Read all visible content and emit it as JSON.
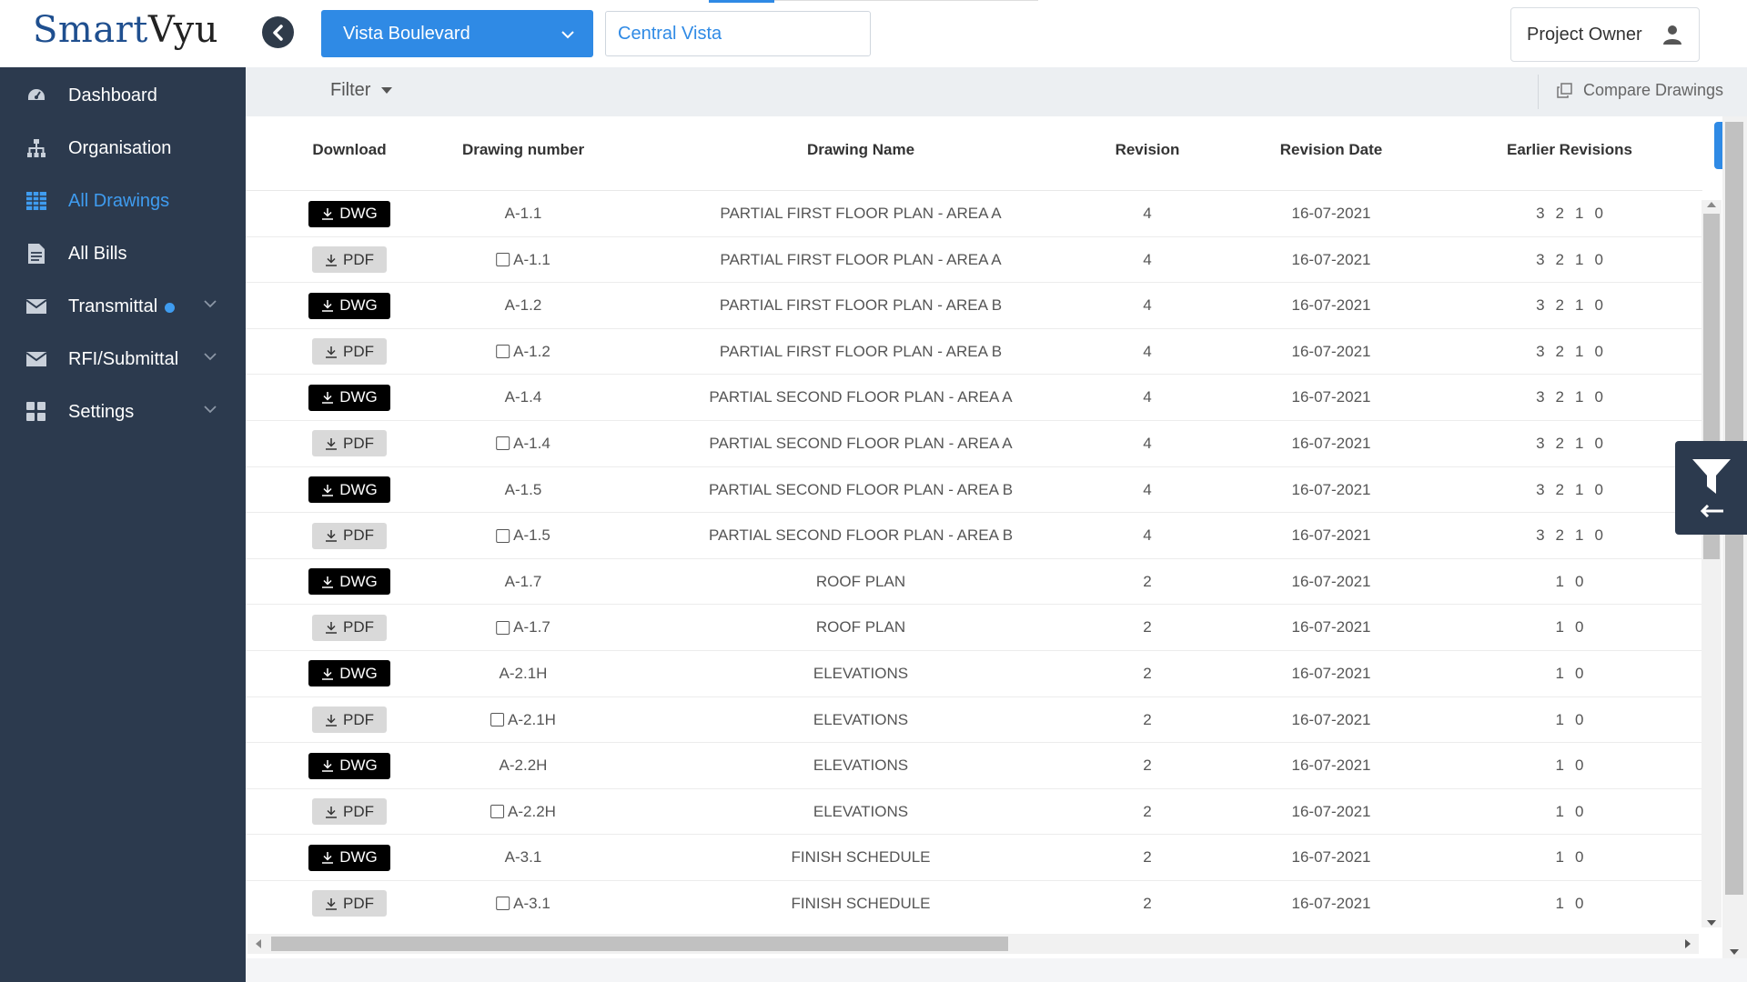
{
  "header": {
    "logo_smart": "Smart",
    "logo_vyu": "Vyu",
    "project_select": "Vista Boulevard",
    "site_input": "Central Vista",
    "user_label": "Project Owner"
  },
  "sidebar": {
    "items": [
      {
        "label": "Dashboard",
        "icon": "dashboard-icon"
      },
      {
        "label": "Organisation",
        "icon": "sitemap-icon"
      },
      {
        "label": "All Drawings",
        "icon": "table-icon",
        "active": true
      },
      {
        "label": "All Bills",
        "icon": "file-text-icon"
      },
      {
        "label": "Transmittal",
        "icon": "envelope-icon",
        "has_dot": true,
        "expandable": true
      },
      {
        "label": "RFI/Submittal",
        "icon": "envelope-icon",
        "expandable": true
      },
      {
        "label": "Settings",
        "icon": "grid-icon",
        "expandable": true
      }
    ]
  },
  "toolbar": {
    "filter_label": "Filter",
    "compare_label": "Compare Drawings"
  },
  "table": {
    "columns": [
      "Download",
      "Drawing number",
      "Drawing Name",
      "Revision",
      "Revision Date",
      "Earlier Revisions"
    ],
    "rows": [
      {
        "type": "DWG",
        "number": "A-1.1",
        "name": "PARTIAL FIRST FLOOR PLAN - AREA A",
        "revision": "4",
        "date": "16-07-2021",
        "earlier": [
          "3",
          "2",
          "1",
          "0"
        ]
      },
      {
        "type": "PDF",
        "number": "A-1.1",
        "name": "PARTIAL FIRST FLOOR PLAN - AREA A",
        "revision": "4",
        "date": "16-07-2021",
        "earlier": [
          "3",
          "2",
          "1",
          "0"
        ]
      },
      {
        "type": "DWG",
        "number": "A-1.2",
        "name": "PARTIAL FIRST FLOOR PLAN - AREA B",
        "revision": "4",
        "date": "16-07-2021",
        "earlier": [
          "3",
          "2",
          "1",
          "0"
        ]
      },
      {
        "type": "PDF",
        "number": "A-1.2",
        "name": "PARTIAL FIRST FLOOR PLAN - AREA B",
        "revision": "4",
        "date": "16-07-2021",
        "earlier": [
          "3",
          "2",
          "1",
          "0"
        ]
      },
      {
        "type": "DWG",
        "number": "A-1.4",
        "name": "PARTIAL SECOND FLOOR PLAN - AREA A",
        "revision": "4",
        "date": "16-07-2021",
        "earlier": [
          "3",
          "2",
          "1",
          "0"
        ]
      },
      {
        "type": "PDF",
        "number": "A-1.4",
        "name": "PARTIAL SECOND FLOOR PLAN - AREA A",
        "revision": "4",
        "date": "16-07-2021",
        "earlier": [
          "3",
          "2",
          "1",
          "0"
        ]
      },
      {
        "type": "DWG",
        "number": "A-1.5",
        "name": "PARTIAL SECOND FLOOR PLAN - AREA B",
        "revision": "4",
        "date": "16-07-2021",
        "earlier": [
          "3",
          "2",
          "1",
          "0"
        ]
      },
      {
        "type": "PDF",
        "number": "A-1.5",
        "name": "PARTIAL SECOND FLOOR PLAN - AREA B",
        "revision": "4",
        "date": "16-07-2021",
        "earlier": [
          "3",
          "2",
          "1",
          "0"
        ]
      },
      {
        "type": "DWG",
        "number": "A-1.7",
        "name": "ROOF PLAN",
        "revision": "2",
        "date": "16-07-2021",
        "earlier": [
          "1",
          "0"
        ]
      },
      {
        "type": "PDF",
        "number": "A-1.7",
        "name": "ROOF PLAN",
        "revision": "2",
        "date": "16-07-2021",
        "earlier": [
          "1",
          "0"
        ]
      },
      {
        "type": "DWG",
        "number": "A-2.1H",
        "name": "ELEVATIONS",
        "revision": "2",
        "date": "16-07-2021",
        "earlier": [
          "1",
          "0"
        ]
      },
      {
        "type": "PDF",
        "number": "A-2.1H",
        "name": "ELEVATIONS",
        "revision": "2",
        "date": "16-07-2021",
        "earlier": [
          "1",
          "0"
        ]
      },
      {
        "type": "DWG",
        "number": "A-2.2H",
        "name": "ELEVATIONS",
        "revision": "2",
        "date": "16-07-2021",
        "earlier": [
          "1",
          "0"
        ]
      },
      {
        "type": "PDF",
        "number": "A-2.2H",
        "name": "ELEVATIONS",
        "revision": "2",
        "date": "16-07-2021",
        "earlier": [
          "1",
          "0"
        ]
      },
      {
        "type": "DWG",
        "number": "A-3.1",
        "name": "FINISH SCHEDULE",
        "revision": "2",
        "date": "16-07-2021",
        "earlier": [
          "1",
          "0"
        ]
      },
      {
        "type": "PDF",
        "number": "A-3.1",
        "name": "FINISH SCHEDULE",
        "revision": "2",
        "date": "16-07-2021",
        "earlier": [
          "1",
          "0"
        ]
      }
    ]
  },
  "colors": {
    "sidebar_bg": "#2c3a4e",
    "accent": "#2f8ae5",
    "dwg_button": "#000000",
    "pdf_button": "#d9d9d9"
  }
}
